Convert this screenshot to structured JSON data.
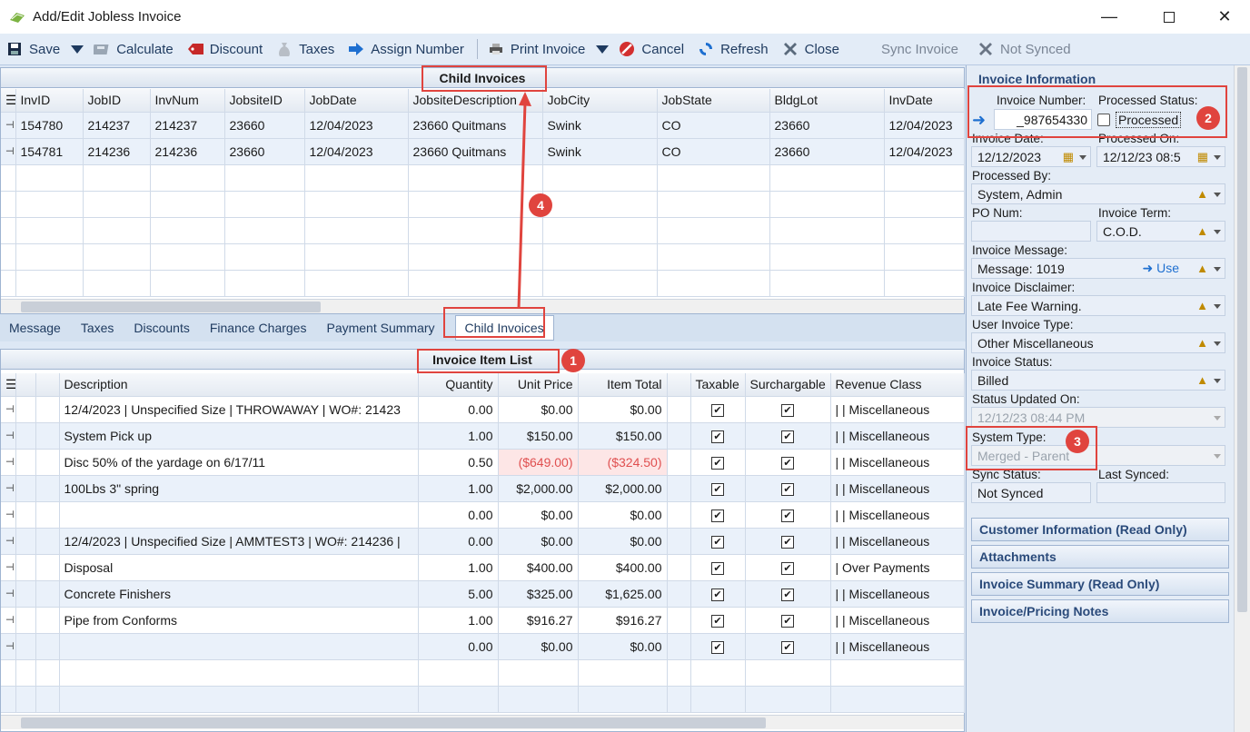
{
  "window": {
    "title": "Add/Edit Jobless Invoice"
  },
  "toolbar": {
    "save": "Save",
    "calculate": "Calculate",
    "discount": "Discount",
    "taxes": "Taxes",
    "assign_number": "Assign Number",
    "print_invoice": "Print Invoice",
    "cancel": "Cancel",
    "refresh": "Refresh",
    "close": "Close",
    "sync_invoice": "Sync Invoice",
    "not_synced": "Not Synced"
  },
  "child_invoices": {
    "title": "Child Invoices",
    "columns": [
      "InvID",
      "JobID",
      "InvNum",
      "JobsiteID",
      "JobDate",
      "JobsiteDescription",
      "JobCity",
      "JobState",
      "BldgLot",
      "InvDate"
    ],
    "rows": [
      [
        "154780",
        "214237",
        "214237",
        "23660",
        "12/04/2023",
        "23660 Quitmans",
        "Swink",
        "CO",
        "23660",
        "12/04/2023"
      ],
      [
        "154781",
        "214236",
        "214236",
        "23660",
        "12/04/2023",
        "23660 Quitmans",
        "Swink",
        "CO",
        "23660",
        "12/04/2023"
      ]
    ]
  },
  "tabs": [
    "Message",
    "Taxes",
    "Discounts",
    "Finance Charges",
    "Payment Summary",
    "Child Invoices"
  ],
  "item_list": {
    "title": "Invoice Item List",
    "columns": [
      "Description",
      "Quantity",
      "Unit Price",
      "Item Total",
      "Taxable",
      "Surchargable",
      "Revenue Class"
    ],
    "rows": [
      {
        "desc": "12/4/2023 | Unspecified Size | THROWAWAY | WO#: 21423",
        "qty": "0.00",
        "price": "$0.00",
        "total": "$0.00",
        "rev": "|  |  Miscellaneous",
        "neg": false
      },
      {
        "desc": "System Pick up",
        "qty": "1.00",
        "price": "$150.00",
        "total": "$150.00",
        "rev": "|  |  Miscellaneous",
        "neg": false
      },
      {
        "desc": "Disc 50% of the yardage on 6/17/11",
        "qty": "0.50",
        "price": "($649.00)",
        "total": "($324.50)",
        "rev": "|  |  Miscellaneous",
        "neg": true
      },
      {
        "desc": "100Lbs 3\" spring",
        "qty": "1.00",
        "price": "$2,000.00",
        "total": "$2,000.00",
        "rev": "|  |  Miscellaneous",
        "neg": false
      },
      {
        "desc": "",
        "qty": "0.00",
        "price": "$0.00",
        "total": "$0.00",
        "rev": "|  |  Miscellaneous",
        "neg": false
      },
      {
        "desc": "12/4/2023 | Unspecified Size | AMMTEST3 | WO#: 214236 |",
        "qty": "0.00",
        "price": "$0.00",
        "total": "$0.00",
        "rev": "|  |  Miscellaneous",
        "neg": false
      },
      {
        "desc": "Disposal",
        "qty": "1.00",
        "price": "$400.00",
        "total": "$400.00",
        "rev": "|  Over Payments",
        "neg": false
      },
      {
        "desc": "Concrete Finishers",
        "qty": "5.00",
        "price": "$325.00",
        "total": "$1,625.00",
        "rev": "|  |  Miscellaneous",
        "neg": false
      },
      {
        "desc": "Pipe from Conforms",
        "qty": "1.00",
        "price": "$916.27",
        "total": "$916.27",
        "rev": "|  |  Miscellaneous",
        "neg": false
      },
      {
        "desc": "",
        "qty": "0.00",
        "price": "$0.00",
        "total": "$0.00",
        "rev": "|  |  Miscellaneous",
        "neg": false
      }
    ]
  },
  "invoice_info": {
    "header": "Invoice Information",
    "invoice_number_label": "Invoice Number:",
    "invoice_number": "_987654330",
    "processed_status_label": "Processed Status:",
    "processed": "Processed",
    "invoice_date_label": "Invoice Date:",
    "invoice_date": "12/12/2023",
    "processed_on_label": "Processed On:",
    "processed_on": "12/12/23 08:5",
    "processed_by_label": "Processed By:",
    "processed_by": "System, Admin",
    "po_num_label": "PO Num:",
    "po_num": "",
    "invoice_term_label": "Invoice Term:",
    "invoice_term": "C.O.D.",
    "invoice_message_label": "Invoice Message:",
    "invoice_message": "Message: 1019",
    "use": "Use",
    "invoice_disclaimer_label": "Invoice Disclaimer:",
    "invoice_disclaimer": "Late Fee Warning.",
    "user_invoice_type_label": "User Invoice Type:",
    "user_invoice_type": "Other Miscellaneous",
    "invoice_status_label": "Invoice Status:",
    "invoice_status": "Billed",
    "status_updated_label": "Status Updated On:",
    "status_updated": "12/12/23 08:44 PM",
    "system_type_label": "System Type:",
    "system_type": "Merged - Parent",
    "sync_status_label": "Sync Status:",
    "sync_status": "Not Synced",
    "last_synced_label": "Last Synced:",
    "last_synced": ""
  },
  "sections": [
    "Customer Information (Read Only)",
    "Attachments",
    "Invoice Summary (Read Only)",
    "Invoice/Pricing Notes"
  ],
  "badges": [
    "1",
    "2",
    "3",
    "4"
  ]
}
